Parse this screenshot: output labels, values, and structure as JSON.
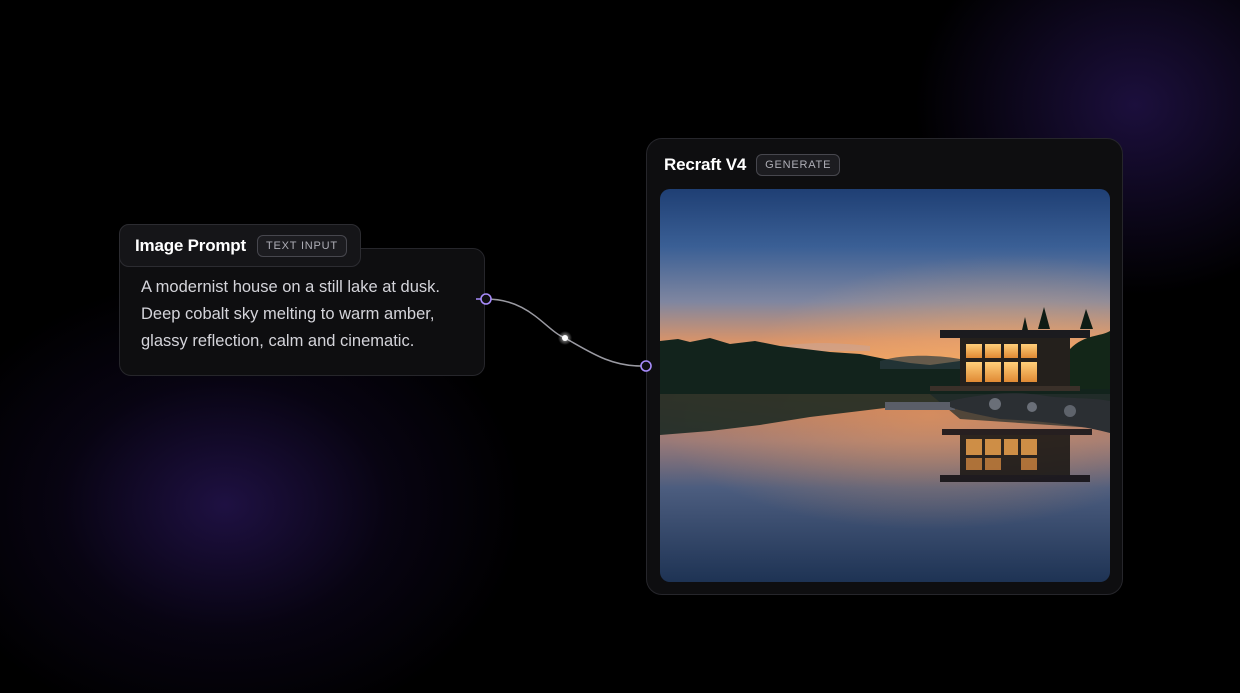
{
  "prompt_node": {
    "title": "Image Prompt",
    "badge": "TEXT INPUT",
    "text": "A modernist house on a still lake at dusk. Deep cobalt sky melting to warm amber, glassy reflection, calm and cinematic."
  },
  "generate_node": {
    "title": "Recraft V4",
    "badge": "GENERATE"
  },
  "colors": {
    "accent": "#a78bfa",
    "background": "#000000",
    "card": "#0e0e10"
  }
}
